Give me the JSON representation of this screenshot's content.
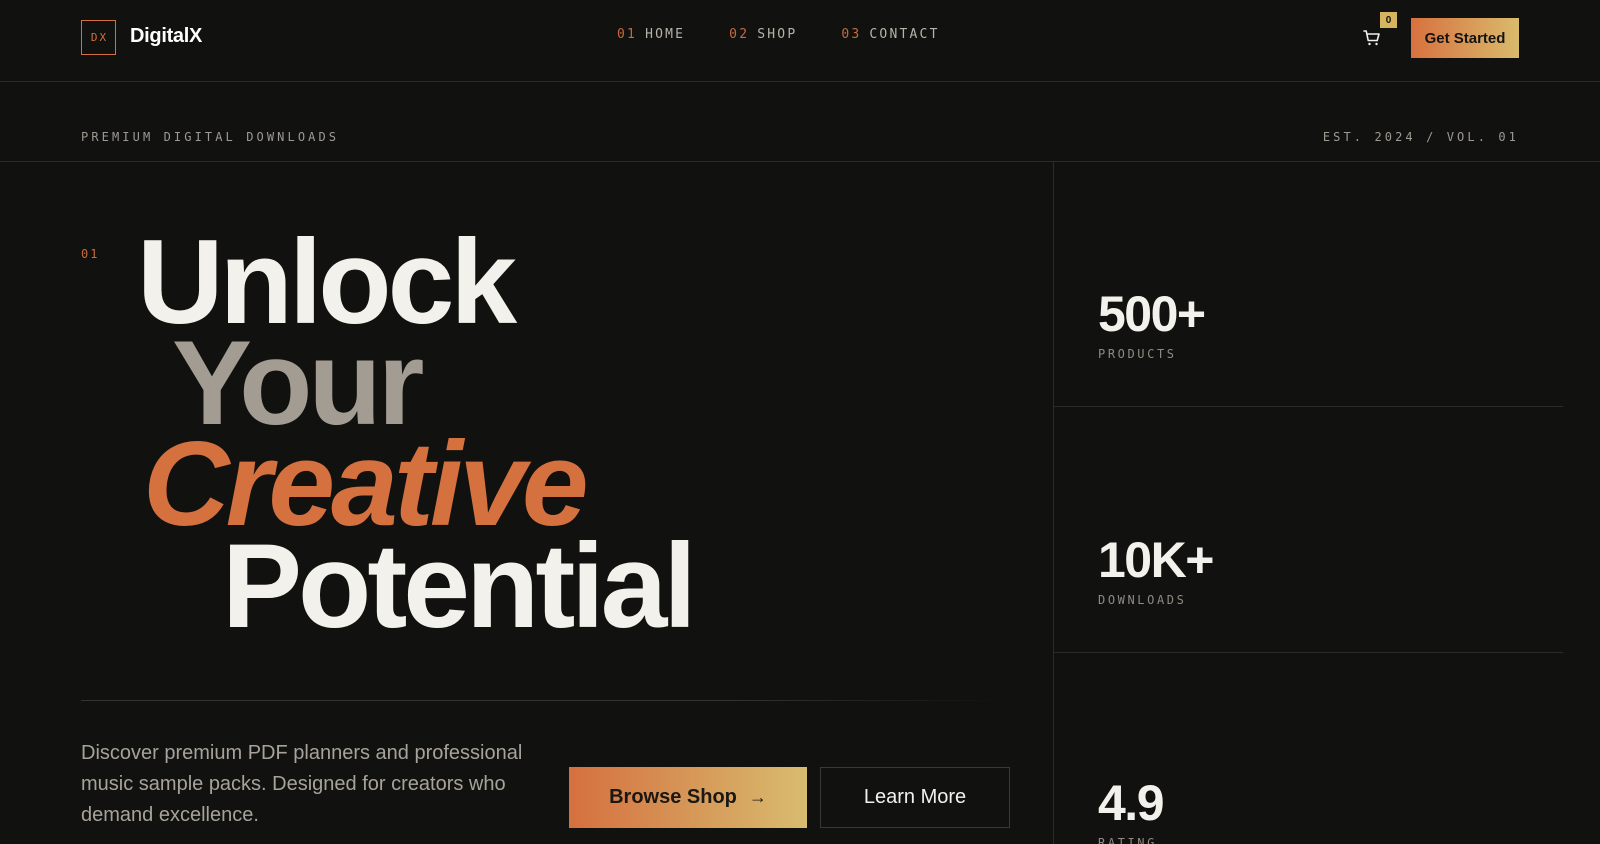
{
  "header": {
    "logo_mark": "DX",
    "brand": "DigitalX",
    "nav": [
      {
        "num": "01",
        "label": "HOME"
      },
      {
        "num": "02",
        "label": "SHOP"
      },
      {
        "num": "03",
        "label": "CONTACT"
      }
    ],
    "cart_count": "0",
    "cta_label": "Get Started"
  },
  "strip": {
    "left": "PREMIUM DIGITAL DOWNLOADS",
    "right": "EST. 2024 / VOL. 01"
  },
  "hero": {
    "section_num": "01",
    "lines": [
      "Unlock",
      "Your",
      "Creative",
      "Potential"
    ],
    "description": "Discover premium PDF planners and professional music sample packs. Designed for creators who demand excellence.",
    "primary_button": "Browse Shop",
    "primary_arrow": "→",
    "secondary_button": "Learn More"
  },
  "stats": [
    {
      "value": "500+",
      "label": "PRODUCTS"
    },
    {
      "value": "10K+",
      "label": "DOWNLOADS"
    },
    {
      "value": "4.9",
      "label": "RATING"
    }
  ],
  "colors": {
    "background": "#11110f",
    "accent_orange": "#d5703f",
    "accent_gold": "#d8bc6f",
    "muted_text": "#a39c92"
  },
  "icons": {
    "cart": "shopping-cart-icon",
    "arrow": "arrow-right-icon"
  }
}
